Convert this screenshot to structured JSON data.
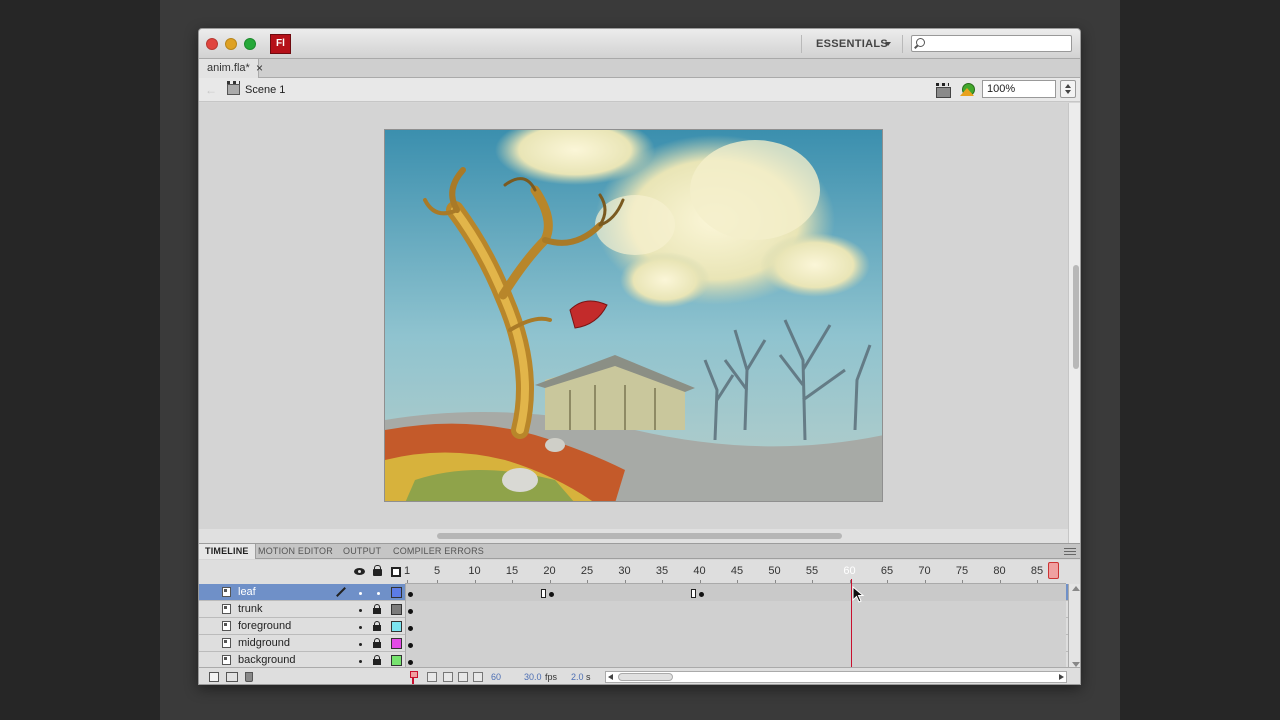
{
  "app": {
    "logo_text": "Fl",
    "workspace": "ESSENTIALS",
    "search": {
      "placeholder": "",
      "value": ""
    }
  },
  "document": {
    "tab_label": "anim.fla*",
    "close_glyph": "×"
  },
  "editbar": {
    "scene_label": "Scene 1",
    "zoom": "100%"
  },
  "panel": {
    "tabs": [
      "TIMELINE",
      "MOTION EDITOR",
      "OUTPUT",
      "COMPILER ERRORS"
    ],
    "active_tab": 0
  },
  "timeline": {
    "ruler_labels": [
      "1",
      "5",
      "10",
      "15",
      "20",
      "25",
      "30",
      "35",
      "40",
      "45",
      "50",
      "55",
      "60",
      "65",
      "70",
      "75",
      "80",
      "85"
    ],
    "current_frame": 60,
    "layers": [
      {
        "name": "leaf",
        "selected": true,
        "locked": false,
        "color": "#5c7ce6"
      },
      {
        "name": "trunk",
        "selected": false,
        "locked": true,
        "color": "#7b7b7b"
      },
      {
        "name": "foreground",
        "selected": false,
        "locked": true,
        "color": "#7be4f0"
      },
      {
        "name": "midground",
        "selected": false,
        "locked": true,
        "color": "#e34ae6"
      },
      {
        "name": "background",
        "selected": false,
        "locked": true,
        "color": "#77e36f"
      }
    ],
    "footer": {
      "frame": "60",
      "fps_value": "30.0",
      "fps_unit": "fps",
      "time_value": "2.0",
      "time_unit": "s"
    }
  },
  "colors": {
    "playhead": "#c8102e",
    "selected_layer": "#6f90c8",
    "value_text": "#4d6fb4"
  }
}
